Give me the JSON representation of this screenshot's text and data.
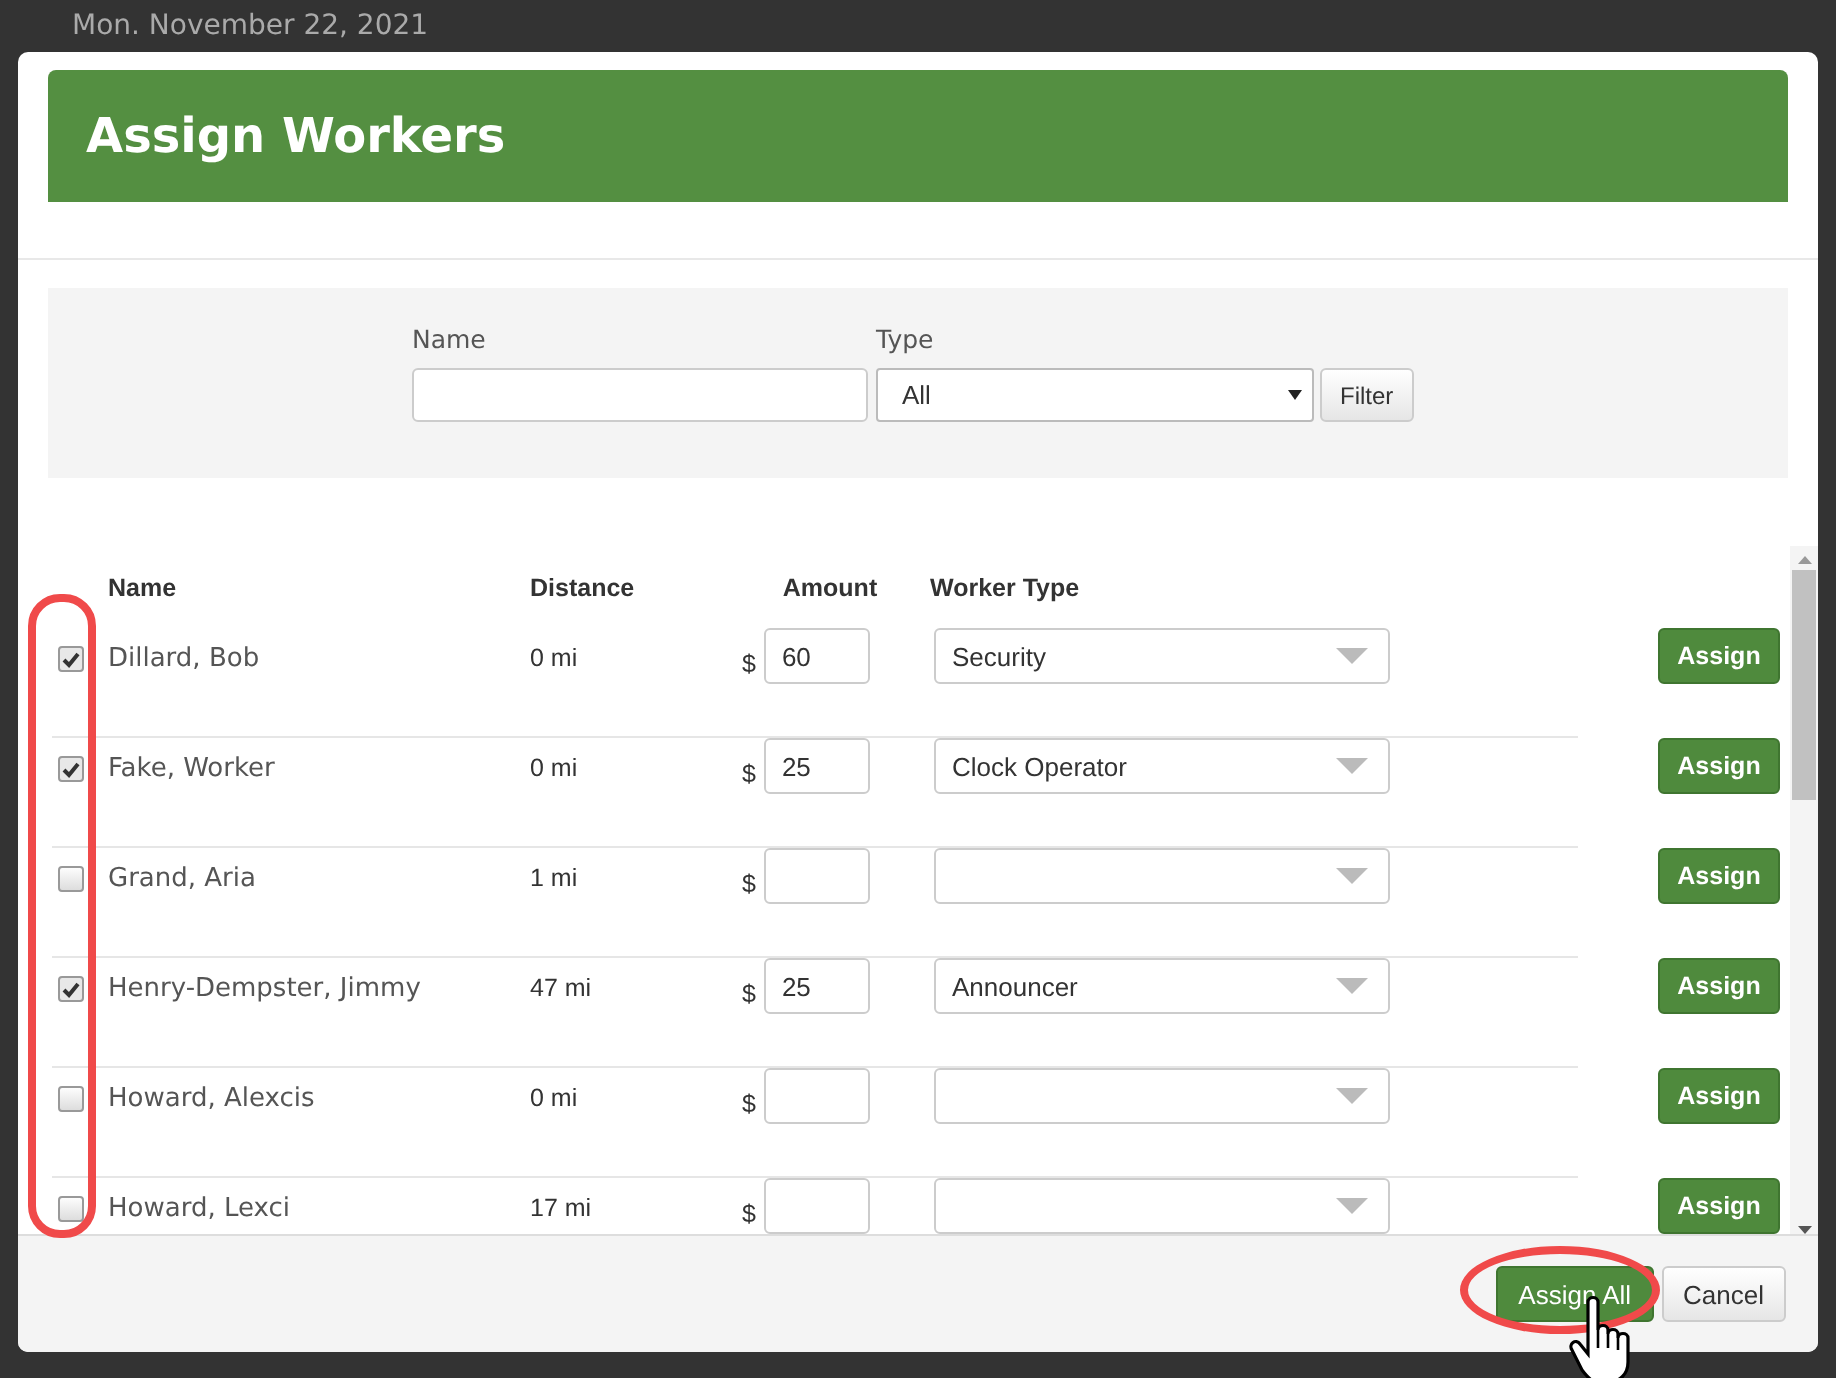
{
  "background": {
    "date": "Mon. November 22, 2021"
  },
  "dialog": {
    "title": "Assign Workers"
  },
  "filter": {
    "name_label": "Name",
    "type_label": "Type",
    "type_value": "All",
    "button": "Filter"
  },
  "table": {
    "columns": [
      "Name",
      "Distance",
      "Amount",
      "Worker Type"
    ],
    "checkboxes_highlighted": true,
    "rows": [
      {
        "checked": true,
        "name": "Dillard, Bob",
        "distance": "0 mi",
        "currency": "$",
        "amount": "60",
        "worker_type": "Security",
        "action": "Assign"
      },
      {
        "checked": true,
        "name": "Fake, Worker",
        "distance": "0 mi",
        "currency": "$",
        "amount": "25",
        "worker_type": "Clock Operator",
        "action": "Assign"
      },
      {
        "checked": false,
        "name": "Grand, Aria",
        "distance": "1 mi",
        "currency": "$",
        "action": "Assign"
      },
      {
        "checked": true,
        "name": "Henry-Dempster, Jimmy",
        "distance": "47 mi",
        "currency": "$",
        "amount": "25",
        "worker_type": "Announcer",
        "action": "Assign"
      },
      {
        "checked": false,
        "name": "Howard, Alexcis",
        "distance": "0 mi",
        "currency": "$",
        "action": "Assign"
      },
      {
        "checked": false,
        "name": "Howard, Lexci",
        "distance": "17 mi",
        "currency": "$",
        "action": "Assign"
      }
    ]
  },
  "footer": {
    "buttons": [
      {
        "label": "Assign All",
        "kind": "primary",
        "highlighted": true
      },
      {
        "label": "Cancel",
        "kind": "default",
        "highlighted": false
      }
    ]
  }
}
